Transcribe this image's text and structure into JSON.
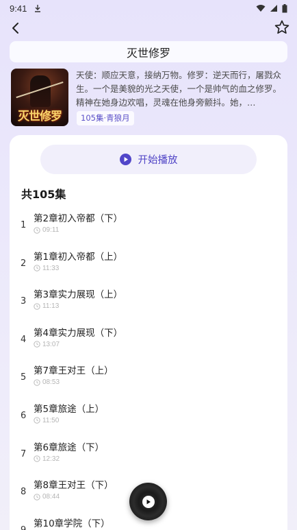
{
  "status_bar": {
    "time": "9:41"
  },
  "header": {
    "title": "灭世修罗"
  },
  "book": {
    "cover_title": "灭世修罗",
    "description": "天使：顺应天意，接纳万物。修罗：逆天而行，屠戮众生。一个是美貌的光之天使，一个是帅气的血之修罗。精神在她身边欢唱，灵魂在他身旁颤抖。她，…",
    "tag": "105集·青狼月"
  },
  "player": {
    "play_label": "开始播放"
  },
  "episodes": {
    "count_label": "共105集",
    "items": [
      {
        "num": "1",
        "title": "第2章初入帝都（下）",
        "duration": "09:11"
      },
      {
        "num": "2",
        "title": "第1章初入帝都（上）",
        "duration": "11:33"
      },
      {
        "num": "3",
        "title": "第3章实力展现（上）",
        "duration": "11:13"
      },
      {
        "num": "4",
        "title": "第4章实力展现（下）",
        "duration": "13:07"
      },
      {
        "num": "5",
        "title": "第7章王对王（上）",
        "duration": "08:53"
      },
      {
        "num": "6",
        "title": "第5章旅途（上）",
        "duration": "11:50"
      },
      {
        "num": "7",
        "title": "第6章旅途（下）",
        "duration": "12:32"
      },
      {
        "num": "8",
        "title": "第8章王对王（下）",
        "duration": "08:44"
      },
      {
        "num": "9",
        "title": "第10章学院（下）",
        "duration": ""
      }
    ]
  },
  "icons": {
    "back": "back-arrow-icon",
    "favorite": "star-icon",
    "play": "play-circle-icon",
    "clock": "clock-icon",
    "now_playing": "vinyl-disc-icon"
  },
  "colors": {
    "accent": "#4f43c6",
    "background": "#e9e6fb",
    "card": "#ffffff"
  }
}
